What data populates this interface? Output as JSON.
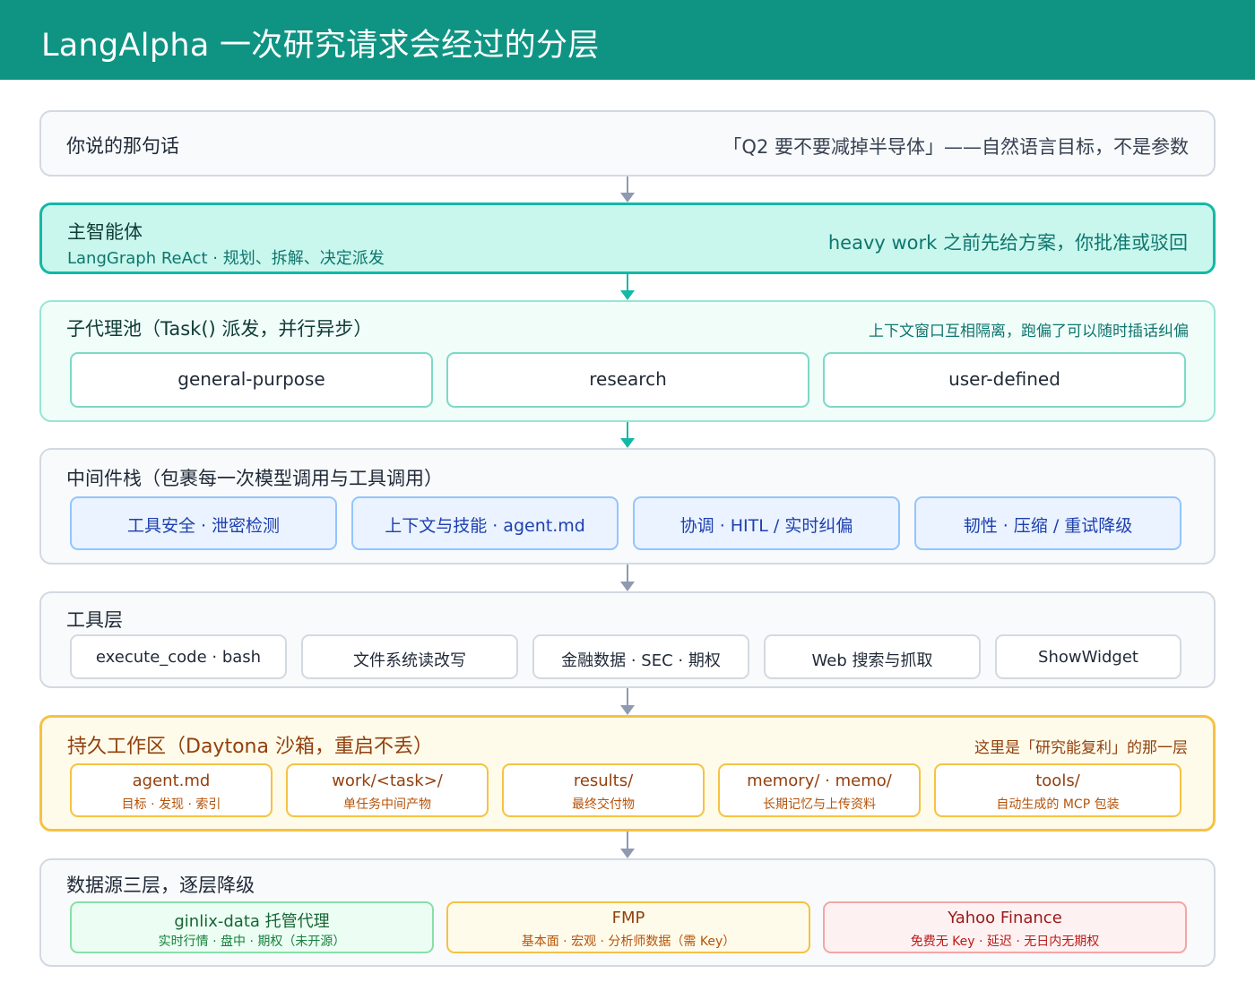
{
  "title": "LangAlpha 一次研究请求会经过的分层",
  "colors": {
    "header": "#0f9483",
    "teal_accent": "#14b8a6",
    "gray_arrow": "#8e9ab0",
    "amber_accent": "#f5c244",
    "blue_chip": "#93c5fd",
    "green_chip": "#86e0a8",
    "red_chip": "#f5a5a5"
  },
  "layers": {
    "request": {
      "title": "你说的那句话",
      "note": "「Q2 要不要减掉半导体」——自然语言目标，不是参数"
    },
    "main_agent": {
      "title": "主智能体",
      "subtitle": "LangGraph ReAct · 规划、拆解、决定派发",
      "note": "heavy work 之前先给方案，你批准或驳回"
    },
    "subagents": {
      "title": "子代理池（Task() 派发，并行异步）",
      "note": "上下文窗口互相隔离，跑偏了可以随时插话纠偏",
      "items": [
        "general-purpose",
        "research",
        "user-defined"
      ]
    },
    "middleware": {
      "title": "中间件栈（包裹每一次模型调用与工具调用）",
      "items": [
        "工具安全 · 泄密检测",
        "上下文与技能 · agent.md",
        "协调 · HITL / 实时纠偏",
        "韧性 · 压缩 / 重试降级"
      ]
    },
    "tools": {
      "title": "工具层",
      "items": [
        "execute_code · bash",
        "文件系统读改写",
        "金融数据 · SEC · 期权",
        "Web 搜索与抓取",
        "ShowWidget"
      ]
    },
    "workspace": {
      "title": "持久工作区（Daytona 沙箱，重启不丢）",
      "note": "这里是「研究能复利」的那一层",
      "items": [
        {
          "name": "agent.md",
          "desc": "目标 · 发现 · 索引"
        },
        {
          "name": "work/<task>/",
          "desc": "单任务中间产物"
        },
        {
          "name": "results/",
          "desc": "最终交付物"
        },
        {
          "name": "memory/ · memo/",
          "desc": "长期记忆与上传资料"
        },
        {
          "name": "tools/",
          "desc": "自动生成的 MCP 包装"
        }
      ]
    },
    "data_sources": {
      "title": "数据源三层，逐层降级",
      "items": [
        {
          "name": "ginlix-data 托管代理",
          "desc": "实时行情 · 盘中 · 期权（未开源）"
        },
        {
          "name": "FMP",
          "desc": "基本面 · 宏观 · 分析师数据（需 Key）"
        },
        {
          "name": "Yahoo Finance",
          "desc": "免费无 Key · 延迟 · 无日内无期权"
        }
      ]
    }
  }
}
